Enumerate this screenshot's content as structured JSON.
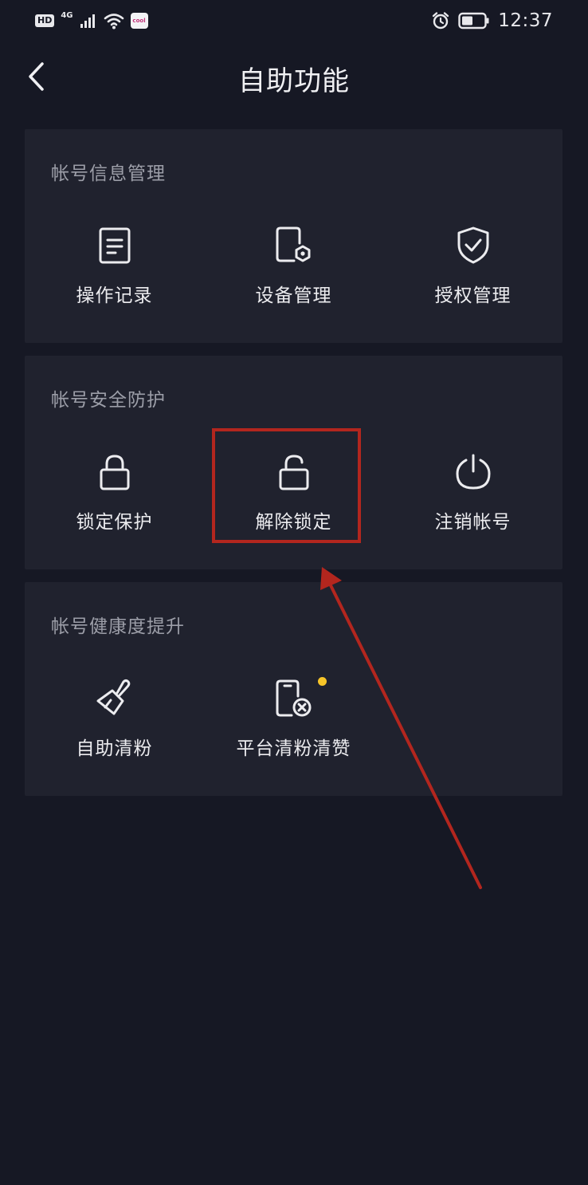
{
  "status_bar": {
    "hd": "HD",
    "network": "4G",
    "app_badge": "cool",
    "time": "12:37"
  },
  "header": {
    "title": "自助功能"
  },
  "sections": [
    {
      "title": "帐号信息管理",
      "items": [
        {
          "label": "操作记录",
          "icon": "document-icon"
        },
        {
          "label": "设备管理",
          "icon": "device-settings-icon"
        },
        {
          "label": "授权管理",
          "icon": "shield-check-icon"
        }
      ]
    },
    {
      "title": "帐号安全防护",
      "items": [
        {
          "label": "锁定保护",
          "icon": "lock-icon"
        },
        {
          "label": "解除锁定",
          "icon": "unlock-icon"
        },
        {
          "label": "注销帐号",
          "icon": "power-icon"
        }
      ]
    },
    {
      "title": "帐号健康度提升",
      "items": [
        {
          "label": "自助清粉",
          "icon": "brush-icon"
        },
        {
          "label": "平台清粉清赞",
          "icon": "phone-remove-icon"
        }
      ]
    }
  ],
  "colors": {
    "background": "#161824",
    "card": "#20222e",
    "annotation": "#b3261e",
    "dot": "#f7c529"
  }
}
